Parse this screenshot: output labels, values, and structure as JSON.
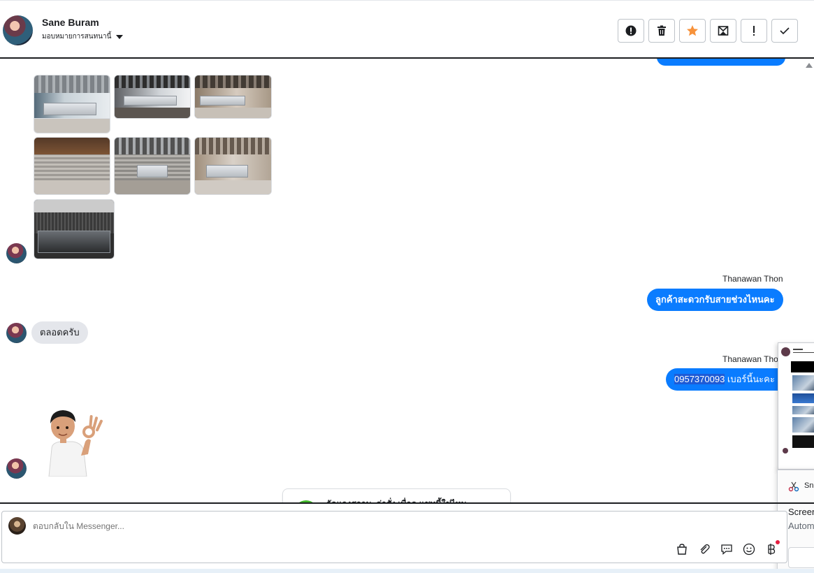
{
  "header": {
    "contact_name": "Sane Buram",
    "assign_label": "มอบหมายการสนทนานี้",
    "actions": [
      {
        "name": "alert-circle",
        "icon": "alert-circle-icon"
      },
      {
        "name": "delete",
        "icon": "trash-icon"
      },
      {
        "name": "star",
        "icon": "star-icon",
        "color": "#f7923b"
      },
      {
        "name": "mark-unread",
        "icon": "envelope-x-icon"
      },
      {
        "name": "important",
        "icon": "exclamation-icon"
      },
      {
        "name": "done",
        "icon": "check-icon"
      }
    ]
  },
  "messages": {
    "sender_out_1": "Thanawan Thon",
    "out_1": "ลูกค้าสะดวกรับสายช่วงไหนคะ",
    "in_1": "ตลอดครับ",
    "sender_out_2": "Thanawan Thon",
    "out_2_highlight": "0957370093",
    "out_2_rest": " เบอร์นี้นะคะ",
    "notice_card": "จัดแจงสถานะด่าสั่ง เพื่อดู แชทนี้ใช่ไหม"
  },
  "composer": {
    "placeholder": "ตอบกลับใน Messenger..."
  },
  "snip_toast": {
    "app_name": "Sn",
    "title": "Screer",
    "subtitle": "Autom"
  },
  "colors": {
    "accent": "#0a7cff",
    "incoming_bubble": "#e4e6eb",
    "star": "#f7923b"
  }
}
